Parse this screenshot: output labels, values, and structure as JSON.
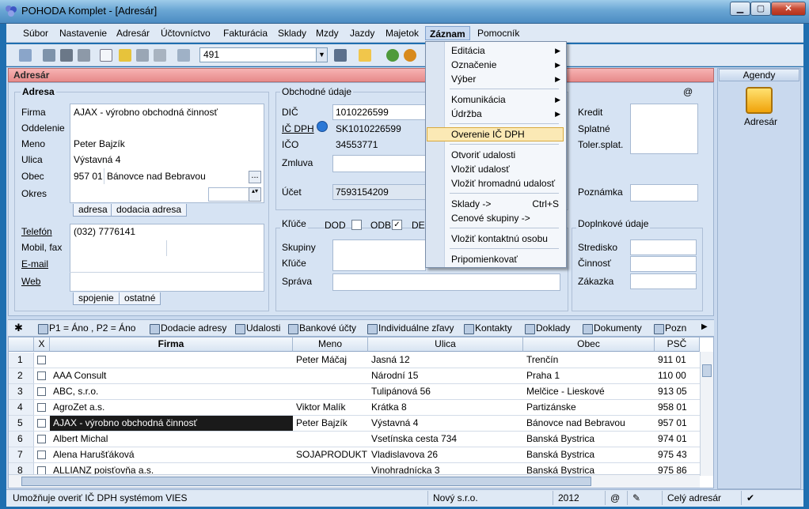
{
  "window": {
    "title": "POHODA Komplet - [Adresár]"
  },
  "menubar": [
    "Súbor",
    "Nastavenie",
    "Adresár",
    "Účtovníctvo",
    "Fakturácia",
    "Sklady",
    "Mzdy",
    "Jazdy",
    "Majetok",
    "Záznam",
    "Pomocník"
  ],
  "toolbar": {
    "combo_value": "491"
  },
  "panel": {
    "title": "Adresár"
  },
  "adresa": {
    "section": "Adresa",
    "labels": {
      "firma": "Firma",
      "oddelenie": "Oddelenie",
      "meno": "Meno",
      "ulica": "Ulica",
      "obec": "Obec",
      "okres": "Okres"
    },
    "values": {
      "firma": "AJAX - výrobno obchodná činnosť",
      "meno": "Peter Bajzík",
      "ulica": "Výstavná 4",
      "psc": "957 01",
      "obec": "Bánovce nad Bebravou"
    },
    "tabs": [
      "adresa",
      "dodacia adresa"
    ]
  },
  "kontakt": {
    "labels": {
      "telefon": "Telefón",
      "mobil": "Mobil, fax",
      "email": "E-mail",
      "web": "Web"
    },
    "values": {
      "telefon": "(032) 7776141"
    },
    "tabs": [
      "spojenie",
      "ostatné"
    ]
  },
  "obchodne": {
    "section": "Obchodné údaje",
    "labels": {
      "dic": "DIČ",
      "icdph": "IČ DPH",
      "ico": "IČO",
      "zmluva": "Zmluva",
      "ucet": "Účet"
    },
    "values": {
      "dic": "1010226599",
      "icdph": "SK1010226599",
      "ico": "34553771",
      "ucet": "7593154209"
    }
  },
  "kluce": {
    "section": "Kľúče",
    "dod": "DOD",
    "odb": "ODB",
    "de": "DE",
    "labels": {
      "skupiny": "Skupiny",
      "kluce": "Kľúče",
      "sprava": "Správa"
    }
  },
  "right": {
    "kredit": "Kredit",
    "splatne": "Splatné",
    "toler": "Toler.splat.",
    "poznamka": "Poznámka",
    "at": "@"
  },
  "doplnkove": {
    "section": "Doplnkové údaje",
    "stredisko": "Stredisko",
    "cinnost": "Činnosť",
    "zakazka": "Zákazka"
  },
  "agendy": {
    "title": "Agendy",
    "item": "Adresár"
  },
  "list_tabs": [
    "P1 = Áno , P2 = Áno",
    "Dodacie adresy",
    "Udalosti",
    "Bankové účty",
    "Individuálne zľavy",
    "Kontakty",
    "Doklady",
    "Dokumenty",
    "Pozn"
  ],
  "grid": {
    "headers": [
      "X",
      "Firma",
      "Meno",
      "Ulica",
      "Obec",
      "PSČ"
    ],
    "rows": [
      {
        "n": "1",
        "firma": "",
        "meno": "Peter  Máčaj",
        "ulica": "Jasná 12",
        "obec": "Trenčín",
        "psc": "911 01"
      },
      {
        "n": "2",
        "firma": "AAA Consult",
        "meno": "",
        "ulica": "Národní 15",
        "obec": "Praha 1",
        "psc": "110 00"
      },
      {
        "n": "3",
        "firma": "ABC, s.r.o.",
        "meno": "",
        "ulica": "Tulipánová 56",
        "obec": "Melčice - Lieskové",
        "psc": "913 05"
      },
      {
        "n": "4",
        "firma": "AgroZet a.s.",
        "meno": "Viktor Malík",
        "ulica": "Krátka 8",
        "obec": "Partizánske",
        "psc": "958 01"
      },
      {
        "n": "5",
        "firma": "AJAX - výrobno obchodná činnosť",
        "meno": "Peter Bajzík",
        "ulica": "Výstavná 4",
        "obec": "Bánovce nad Bebravou",
        "psc": "957 01"
      },
      {
        "n": "6",
        "firma": "Albert Michal",
        "meno": "",
        "ulica": "Vsetínska cesta 734",
        "obec": "Banská Bystrica",
        "psc": "974 01"
      },
      {
        "n": "7",
        "firma": "Alena Harušťáková",
        "meno": "SOJAPRODUKT",
        "ulica": "Vladislavova 26",
        "obec": "Banská Bystrica",
        "psc": "975 43"
      },
      {
        "n": "8",
        "firma": "ALLIANZ poisťovňa a.s.",
        "meno": "",
        "ulica": "Vinohradnícka 3",
        "obec": "Banská Bystrica",
        "psc": "975 86"
      }
    ]
  },
  "dropdown": {
    "items": [
      "Editácia",
      "Označenie",
      "Výber",
      "Komunikácia",
      "Údržba",
      "Overenie IČ DPH",
      "Otvoriť udalosti",
      "Vložiť udalosť",
      "Vložiť hromadnú udalosť",
      "Sklady ->",
      "Cenové skupiny ->",
      "Vložiť kontaktnú osobu",
      "Pripomienkovať"
    ],
    "shortcut_sklady": "Ctrl+S"
  },
  "status": {
    "hint": "Umožňuje overiť IČ DPH systémom VIES",
    "company": "Nový s.r.o.",
    "year": "2012",
    "at": "@",
    "filter": "Celý adresár"
  }
}
